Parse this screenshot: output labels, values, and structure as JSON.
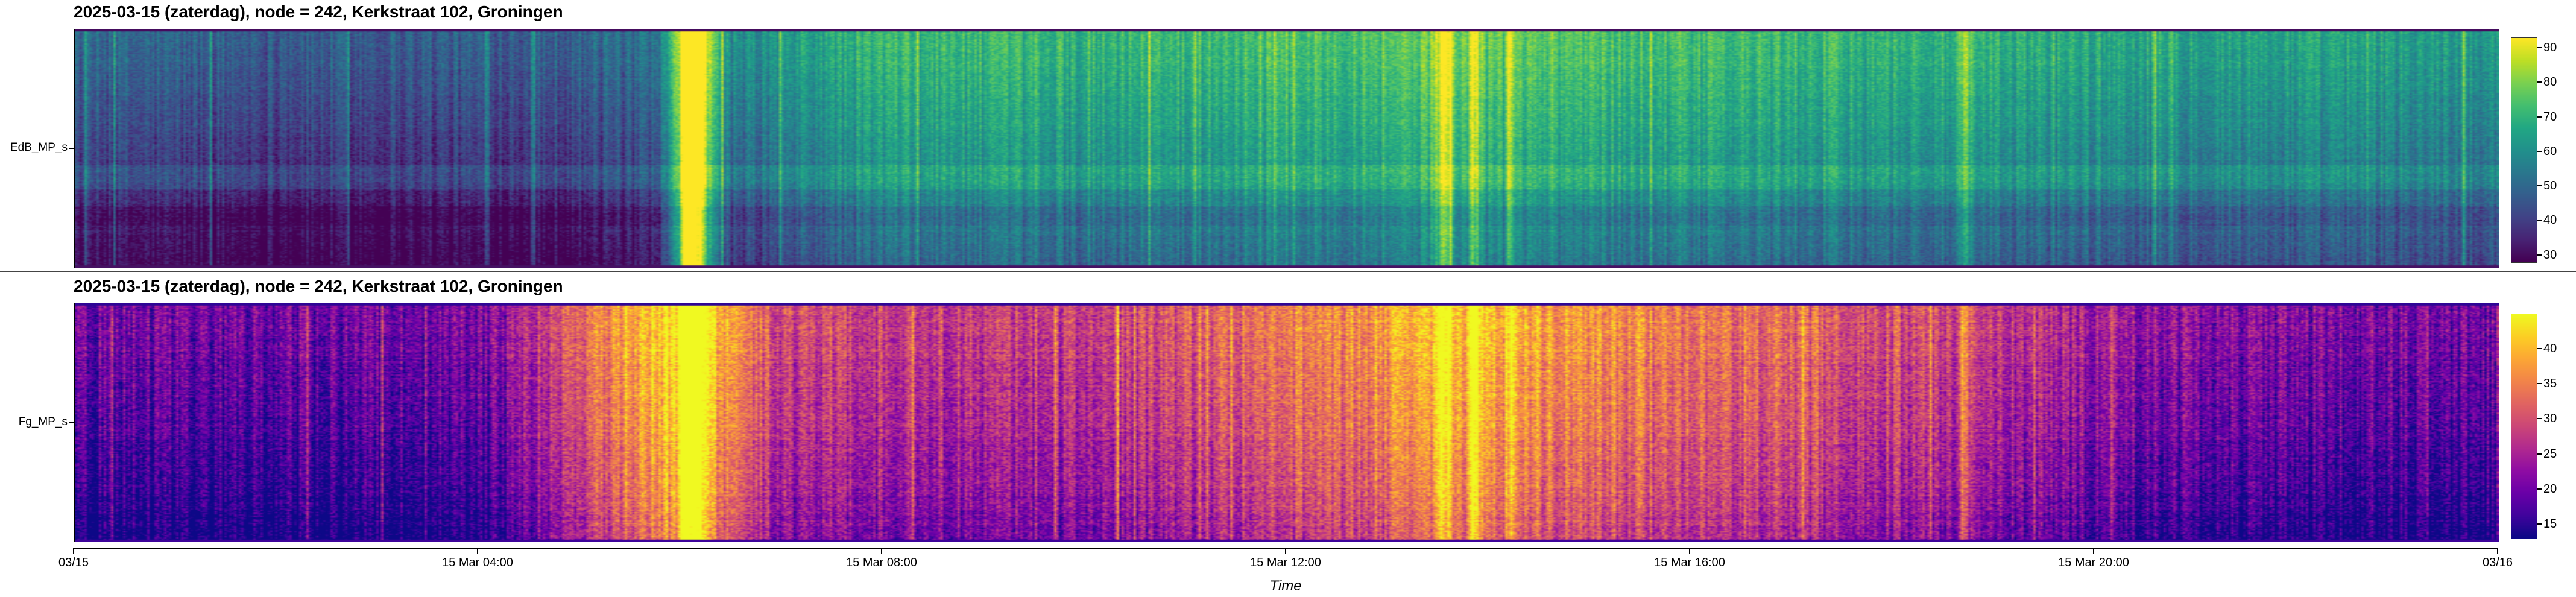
{
  "colors": {
    "panel1_colormap": "viridis",
    "panel2_colormap": "plasma",
    "axis": "#000000",
    "divider": "#444444"
  },
  "chart_data": [
    {
      "type": "heatmap",
      "title": "2025-03-15 (zaterdag), node = 242, Kerkstraat 102, Groningen",
      "ylabel": "EdB_MP_s",
      "xlabel": "",
      "x_range": [
        "2025-03-15 00:00",
        "2025-03-16 00:00"
      ],
      "colorbar": {
        "cmap": "viridis",
        "range": [
          28,
          93
        ],
        "ticks": [
          30,
          40,
          50,
          60,
          70,
          80,
          90
        ]
      },
      "y_profile_description_values": [
        78,
        70,
        64,
        60,
        58,
        56,
        54,
        52,
        50,
        48,
        46,
        44,
        42,
        40,
        38,
        36
      ],
      "time_mean_level": [
        {
          "t": "00:00",
          "level": 40
        },
        {
          "t": "02:00",
          "level": 38
        },
        {
          "t": "04:00",
          "level": 38
        },
        {
          "t": "05:45",
          "level": 41
        },
        {
          "t": "06:05",
          "level": 88
        },
        {
          "t": "06:30",
          "level": 48
        },
        {
          "t": "08:00",
          "level": 62
        },
        {
          "t": "10:00",
          "level": 60
        },
        {
          "t": "13:30",
          "level": 68
        },
        {
          "t": "16:00",
          "level": 63
        },
        {
          "t": "20:00",
          "level": 58
        },
        {
          "t": "23:59",
          "level": 54
        }
      ]
    },
    {
      "type": "heatmap",
      "title": "2025-03-15 (zaterdag), node = 242, Kerkstraat 102, Groningen",
      "ylabel": "Fg_MP_s",
      "xlabel": "Time",
      "x_range": [
        "2025-03-15 00:00",
        "2025-03-16 00:00"
      ],
      "x_ticks": [
        "03/15",
        "15 Mar 04:00",
        "15 Mar 08:00",
        "15 Mar 12:00",
        "15 Mar 16:00",
        "15 Mar 20:00",
        "03/16"
      ],
      "colorbar": {
        "cmap": "plasma",
        "range": [
          13,
          45
        ],
        "ticks": [
          15,
          20,
          25,
          30,
          35,
          40
        ]
      },
      "time_mean_level": [
        {
          "t": "00:00",
          "level": 18
        },
        {
          "t": "04:00",
          "level": 18
        },
        {
          "t": "06:05",
          "level": 44
        },
        {
          "t": "07:00",
          "level": 27
        },
        {
          "t": "10:00",
          "level": 26
        },
        {
          "t": "13:40",
          "level": 38
        },
        {
          "t": "18:00",
          "level": 28
        },
        {
          "t": "21:00",
          "level": 20
        },
        {
          "t": "23:59",
          "level": 18
        }
      ]
    }
  ]
}
